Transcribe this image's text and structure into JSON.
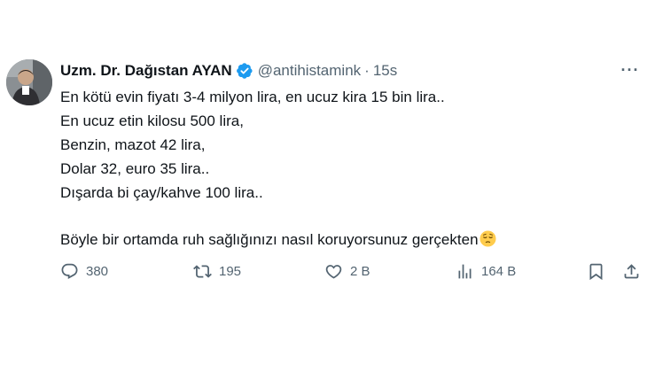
{
  "tweet": {
    "author_name": "Uzm. Dr. Dağıstan AYAN",
    "handle": "@antihistamink",
    "separator": "·",
    "time": "15s",
    "more_label": "···",
    "lines": [
      "En kötü evin fiyatı 3-4 milyon lira, en ucuz kira 15 bin lira..",
      "En ucuz etin kilosu 500 lira,",
      "Benzin, mazot 42 lira,",
      "Dolar 32, euro 35 lira..",
      "Dışarda bi çay/kahve 100 lira.."
    ],
    "last_line": "Böyle bir ortamda ruh sağlığınızı nasıl koruyorsunuz gerçekten",
    "emoji": "pensive-face-emoji"
  },
  "actions": {
    "replies": "380",
    "retweets": "195",
    "likes": "2 B",
    "views": "164 B"
  },
  "icons": {
    "reply": "reply-icon",
    "retweet": "retweet-icon",
    "like": "heart-icon",
    "views": "views-icon",
    "bookmark": "bookmark-icon",
    "share": "share-icon",
    "verified": "verified-badge-icon"
  },
  "colors": {
    "text": "#0f1419",
    "secondary": "#536471",
    "verified": "#1d9bf0"
  }
}
